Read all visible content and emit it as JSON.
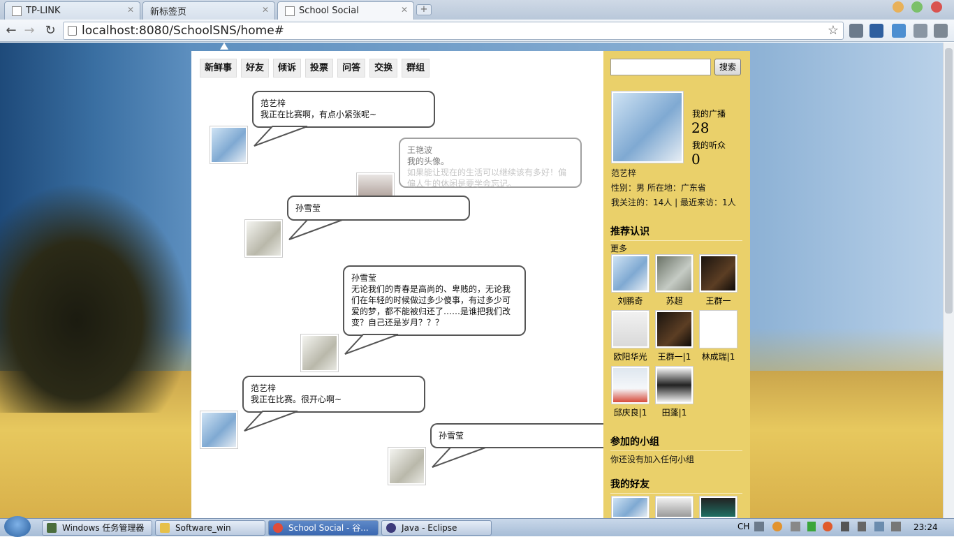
{
  "browser": {
    "tabs": [
      {
        "label": "TP-LINK",
        "active": false
      },
      {
        "label": "新标签页",
        "active": false
      },
      {
        "label": "School Social",
        "active": true
      }
    ],
    "url": "localhost:8080/SchoolSNS/home#"
  },
  "nav": {
    "tabs": [
      "新鲜事",
      "好友",
      "倾诉",
      "投票",
      "问答",
      "交换",
      "群组"
    ]
  },
  "feed": [
    {
      "name": "范艺梓",
      "text": "我正在比赛啊，有点小紧张呢~",
      "avatar": "wind-chime-avatar"
    },
    {
      "name": "王艳波",
      "text": "我的头像。",
      "ghost_text": "如果能让现在的生活可以继续该有多好！偏偏人生的休闲是要学会忘记。",
      "avatar": "girl-avatar"
    },
    {
      "name": "孙雪莹",
      "text": "",
      "avatar": "chopsticks-avatar"
    },
    {
      "name": "孙雪莹",
      "text": "无论我们的青春是高尚的、卑贱的，无论我们在年轻的时候做过多少傻事，有过多少可爱的梦，都不能被归还了……是谁把我们改变？自己还是岁月？？？",
      "avatar": "chopsticks-avatar"
    },
    {
      "name": "范艺梓",
      "text": "我正在比赛。很开心啊~",
      "avatar": "wind-chime-avatar"
    },
    {
      "name": "孙雪莹",
      "text": "",
      "avatar": "chopsticks-avatar"
    }
  ],
  "sidebar": {
    "search_button": "搜索",
    "search_value": "",
    "my_broadcasts_label": "我的广播",
    "my_broadcasts_count": "28",
    "my_listeners_label": "我的听众",
    "my_listeners_count": "0",
    "username": "范艺梓",
    "gender_location": "性别：男 所在地：广东省",
    "follow_visit": "我关注的：14人 | 最近来访：1人",
    "recommend_title": "推荐认识",
    "more_link": "更多",
    "recommend": [
      {
        "name": "刘鹏奇",
        "img": "bells"
      },
      {
        "name": "苏超",
        "img": "can"
      },
      {
        "name": "王群一",
        "img": "dark"
      },
      {
        "name": "欧阳华光",
        "img": "person"
      },
      {
        "name": "王群一|1",
        "img": "dark"
      },
      {
        "name": "林成瑞|1",
        "img": "clock"
      },
      {
        "name": "邱庆良|1",
        "img": "snowman"
      },
      {
        "name": "田蓬|1",
        "img": "piano"
      }
    ],
    "groups_title": "参加的小组",
    "groups_empty": "你还没有加入任何小组",
    "friends_title": "我的好友"
  },
  "taskbar": {
    "items": [
      {
        "label": "Windows 任务管理器",
        "active": false
      },
      {
        "label": "Software_win",
        "active": false
      },
      {
        "label": "School Social - 谷...",
        "active": true
      },
      {
        "label": "Java - Eclipse",
        "active": false
      }
    ],
    "lang": "CH",
    "time": "23:24"
  },
  "colors": {
    "sidebar_bg": "#ead06a",
    "active_task": "#3b68b1"
  }
}
